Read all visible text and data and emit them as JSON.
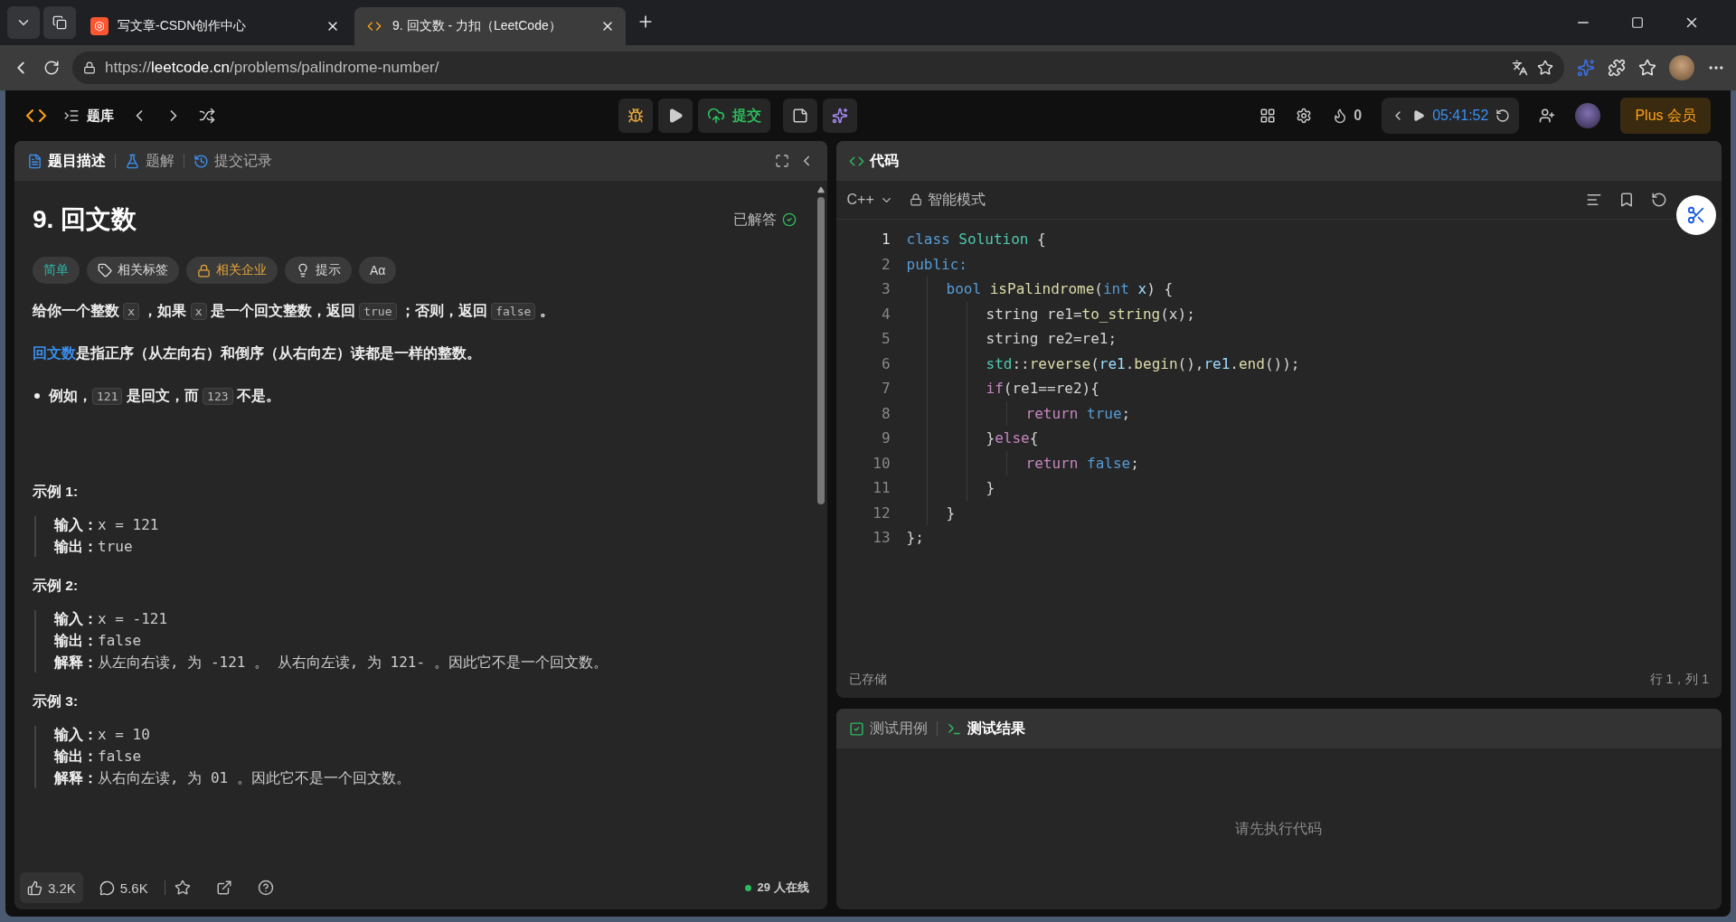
{
  "browser": {
    "tabs": [
      {
        "title": "写文章-CSDN创作中心",
        "selected": false,
        "kind": "csdn"
      },
      {
        "title": "9. 回文数 - 力扣（LeetCode）",
        "selected": true,
        "kind": "leetcode"
      }
    ],
    "url": [
      {
        "text": "https://",
        "kind": "dim"
      },
      {
        "text": "leetcode.cn",
        "kind": "host"
      },
      {
        "text": "/problems/palindrome-number/",
        "kind": "dim"
      }
    ]
  },
  "topbar": {
    "problem_list": "题库",
    "submit": "提交",
    "streak": "0",
    "timer": "05:41:52",
    "plus": "Plus 会员"
  },
  "left_tabs": [
    {
      "label": "题目描述",
      "selected": true,
      "kind": "doc"
    },
    {
      "label": "题解",
      "selected": false,
      "kind": "flask"
    },
    {
      "label": "提交记录",
      "selected": false,
      "kind": "history"
    }
  ],
  "problem": {
    "title": "9. 回文数",
    "status": "已解答",
    "tags": [
      {
        "label": "简单",
        "kind": "difficulty"
      },
      {
        "label": "相关标签",
        "kind": "tag"
      },
      {
        "label": "相关企业",
        "kind": "lock"
      },
      {
        "label": "提示",
        "kind": "bulb"
      },
      {
        "label": "Aα",
        "kind": "translate"
      }
    ],
    "paragraphs": [
      [
        {
          "text": "给你一个整数 ",
          "kind": "text"
        },
        {
          "text": "x",
          "kind": "code"
        },
        {
          "text": " ，如果 ",
          "kind": "text"
        },
        {
          "text": "x",
          "kind": "code"
        },
        {
          "text": " 是一个回文整数，返回 ",
          "kind": "text"
        },
        {
          "text": "true",
          "kind": "code"
        },
        {
          "text": " ；否则，返回 ",
          "kind": "text"
        },
        {
          "text": "false",
          "kind": "code"
        },
        {
          "text": " 。",
          "kind": "text"
        }
      ],
      [
        {
          "text": "回文数",
          "kind": "link"
        },
        {
          "text": "是指正序（从左向右）和倒序（从右向左）读都是一样的整数。",
          "kind": "text"
        }
      ]
    ],
    "bullets": [
      [
        {
          "text": "例如，",
          "kind": "text"
        },
        {
          "text": "121",
          "kind": "code"
        },
        {
          "text": " 是回文，而 ",
          "kind": "text"
        },
        {
          "text": "123",
          "kind": "code"
        },
        {
          "text": " 不是。",
          "kind": "text"
        }
      ]
    ],
    "examples": [
      {
        "title": "示例 1:",
        "lines": [
          {
            "label": "输入：",
            "value": "x = 121"
          },
          {
            "label": "输出：",
            "value": "true"
          }
        ]
      },
      {
        "title": "示例 2:",
        "lines": [
          {
            "label": "输入：",
            "value": "x = -121"
          },
          {
            "label": "输出：",
            "value": "false"
          },
          {
            "label": "解释：",
            "value": "从左向右读, 为 -121 。 从右向左读, 为 121- 。因此它不是一个回文数。"
          }
        ]
      },
      {
        "title": "示例 3:",
        "lines": [
          {
            "label": "输入：",
            "value": "x = 10"
          },
          {
            "label": "输出：",
            "value": "false"
          },
          {
            "label": "解释：",
            "value": "从右向左读, 为 01 。因此它不是一个回文数。"
          }
        ]
      }
    ]
  },
  "footer": {
    "likes": "3.2K",
    "comments": "5.6K",
    "online": "29 人在线"
  },
  "editor": {
    "title": "代码",
    "language": "C++",
    "mode": "智能模式",
    "code": [
      {
        "tokens": [
          {
            "text": "class ",
            "kind": "kw"
          },
          {
            "text": "Solution",
            "kind": "type"
          },
          {
            "text": " {",
            "kind": "plain"
          }
        ]
      },
      {
        "tokens": [
          {
            "text": "public:",
            "kind": "kw"
          }
        ],
        "children": [
          {
            "tokens": [
              {
                "text": "bool ",
                "kind": "kw"
              },
              {
                "text": "isPalindrome",
                "kind": "fn"
              },
              {
                "text": "(",
                "kind": "plain"
              },
              {
                "text": "int ",
                "kind": "kw"
              },
              {
                "text": "x",
                "kind": "var"
              },
              {
                "text": ") {",
                "kind": "plain"
              }
            ],
            "children": [
              {
                "tokens": [
                  {
                    "text": "string re1=",
                    "kind": "plain"
                  },
                  {
                    "text": "to_string",
                    "kind": "fn"
                  },
                  {
                    "text": "(x);",
                    "kind": "plain"
                  }
                ]
              },
              {
                "tokens": [
                  {
                    "text": "string re2=re1;",
                    "kind": "plain"
                  }
                ]
              },
              {
                "tokens": [
                  {
                    "text": "std",
                    "kind": "type"
                  },
                  {
                    "text": "::",
                    "kind": "plain"
                  },
                  {
                    "text": "reverse",
                    "kind": "fn"
                  },
                  {
                    "text": "(",
                    "kind": "plain"
                  },
                  {
                    "text": "re1",
                    "kind": "var"
                  },
                  {
                    "text": ".",
                    "kind": "plain"
                  },
                  {
                    "text": "begin",
                    "kind": "fn"
                  },
                  {
                    "text": "(),",
                    "kind": "plain"
                  },
                  {
                    "text": "re1",
                    "kind": "var"
                  },
                  {
                    "text": ".",
                    "kind": "plain"
                  },
                  {
                    "text": "end",
                    "kind": "fn"
                  },
                  {
                    "text": "());",
                    "kind": "plain"
                  }
                ]
              },
              {
                "tokens": [
                  {
                    "text": "if",
                    "kind": "ctrl"
                  },
                  {
                    "text": "(re1==re2){",
                    "kind": "plain"
                  }
                ],
                "children": [
                  {
                    "tokens": [
                      {
                        "text": "return ",
                        "kind": "ctrl"
                      },
                      {
                        "text": "true",
                        "kind": "kw"
                      },
                      {
                        "text": ";",
                        "kind": "plain"
                      }
                    ]
                  }
                ]
              },
              {
                "tokens": [
                  {
                    "text": "}",
                    "kind": "plain"
                  },
                  {
                    "text": "else",
                    "kind": "ctrl"
                  },
                  {
                    "text": "{",
                    "kind": "plain"
                  }
                ],
                "children": [
                  {
                    "tokens": [
                      {
                        "text": "return ",
                        "kind": "ctrl"
                      },
                      {
                        "text": "false",
                        "kind": "kw"
                      },
                      {
                        "text": ";",
                        "kind": "plain"
                      }
                    ]
                  }
                ]
              },
              {
                "tokens": [
                  {
                    "text": "}",
                    "kind": "plain"
                  }
                ]
              }
            ]
          },
          {
            "tokens": [
              {
                "text": "}",
                "kind": "plain"
              }
            ]
          }
        ]
      },
      {
        "tokens": [
          {
            "text": "};",
            "kind": "plain"
          }
        ]
      }
    ],
    "line_numbers": [
      "1",
      "2",
      "3",
      "4",
      "5",
      "6",
      "7",
      "8",
      "9",
      "10",
      "11",
      "12",
      "13"
    ],
    "saved": "已存储",
    "cursor": "行 1，列 1"
  },
  "test_tabs": [
    {
      "label": "测试用例",
      "selected": false,
      "kind": "check"
    },
    {
      "label": "测试结果",
      "selected": true,
      "kind": "terminal"
    }
  ],
  "test_empty": "请先执行代码"
}
